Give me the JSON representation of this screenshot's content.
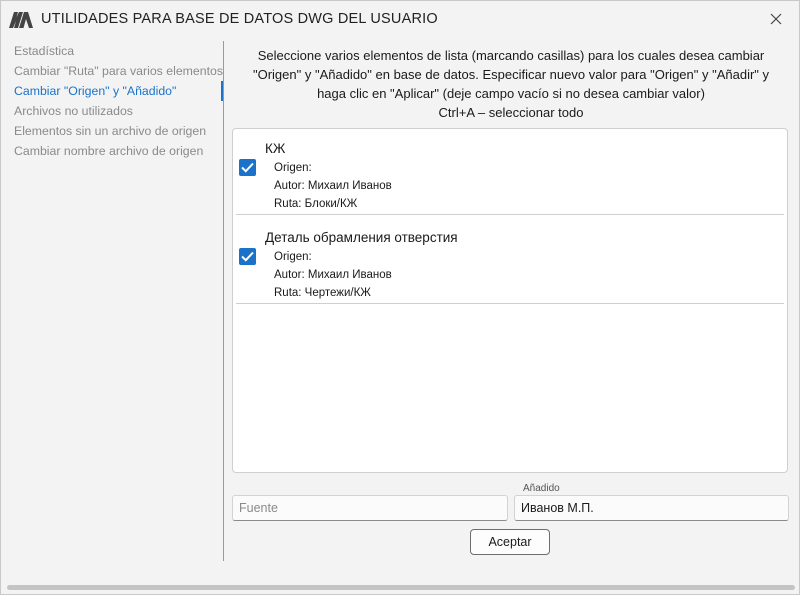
{
  "window": {
    "title": "UTILIDADES PARA BASE DE DATOS DWG DEL USUARIO"
  },
  "sidebar": {
    "items": [
      {
        "label": "Estadística"
      },
      {
        "label": "Cambiar \"Ruta\" para varios elementos"
      },
      {
        "label": "Cambiar \"Origen\" y \"Añadido\""
      },
      {
        "label": "Archivos no utilizados"
      },
      {
        "label": "Elementos sin un archivo de origen"
      },
      {
        "label": "Cambiar nombre archivo de origen"
      }
    ],
    "active_index": 2
  },
  "main": {
    "description": [
      "Seleccione varios elementos de lista (marcando casillas) para los cuales desea cambiar",
      "\"Origen\" y \"Añadido\" en base de datos. Especificar nuevo valor para \"Origen\" y \"Añadir\" y",
      "haga clic en \"Aplicar\" (deje campo vacío si no desea cambiar valor)",
      "Ctrl+A – seleccionar todo"
    ],
    "items": [
      {
        "title": "КЖ",
        "checked": true,
        "origin": "Origen:",
        "author": "Autor: Михаил Иванов",
        "path": "Ruta: Блоки/КЖ"
      },
      {
        "title": "Деталь обрамления отверстия",
        "checked": true,
        "origin": "Origen:",
        "author": "Autor: Михаил Иванов",
        "path": "Ruta: Чертежи/КЖ"
      }
    ],
    "source_field": {
      "placeholder": "Fuente",
      "value": ""
    },
    "added_field": {
      "caption": "Añadido",
      "value": "Иванов М.П."
    },
    "accept_label": "Aceptar"
  },
  "colors": {
    "accent": "#1a73c9",
    "background": "#f3f3f3",
    "muted_text": "#8a8a8a"
  },
  "icons": {
    "logo": "app-logo-icon",
    "close": "close-icon",
    "check": "checkmark-icon"
  }
}
